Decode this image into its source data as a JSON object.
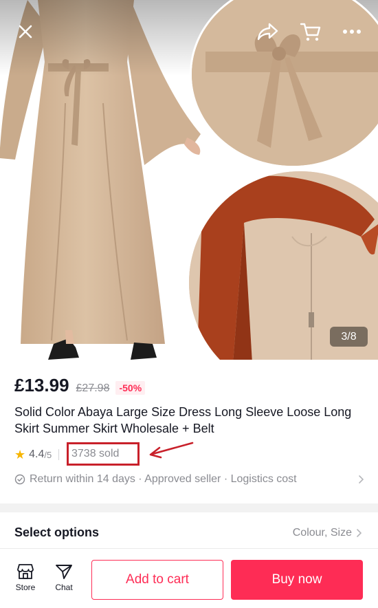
{
  "gallery": {
    "indicator": "3/8",
    "icons": [
      "close-icon",
      "share-icon",
      "cart-icon",
      "more-icon"
    ]
  },
  "product": {
    "price": "£13.99",
    "original_price": "£27.98",
    "discount": "-50%",
    "title": "Solid Color Abaya Large Size Dress Long Sleeve Loose Long Skirt Summer Skirt Wholesale + Belt",
    "rating": "4.4",
    "rating_max": "/5",
    "sold": "3738 sold",
    "service_info": "Return within 14 days · Approved seller · Logistics cost"
  },
  "options": {
    "label": "Select options",
    "value": "Colour, Size"
  },
  "bottom_bar": {
    "store_label": "Store",
    "chat_label": "Chat",
    "add_to_cart": "Add to cart",
    "buy_now": "Buy now"
  },
  "colors": {
    "accent": "#fe2c55",
    "annotation": "#c8202a",
    "star": "#f7b500"
  }
}
